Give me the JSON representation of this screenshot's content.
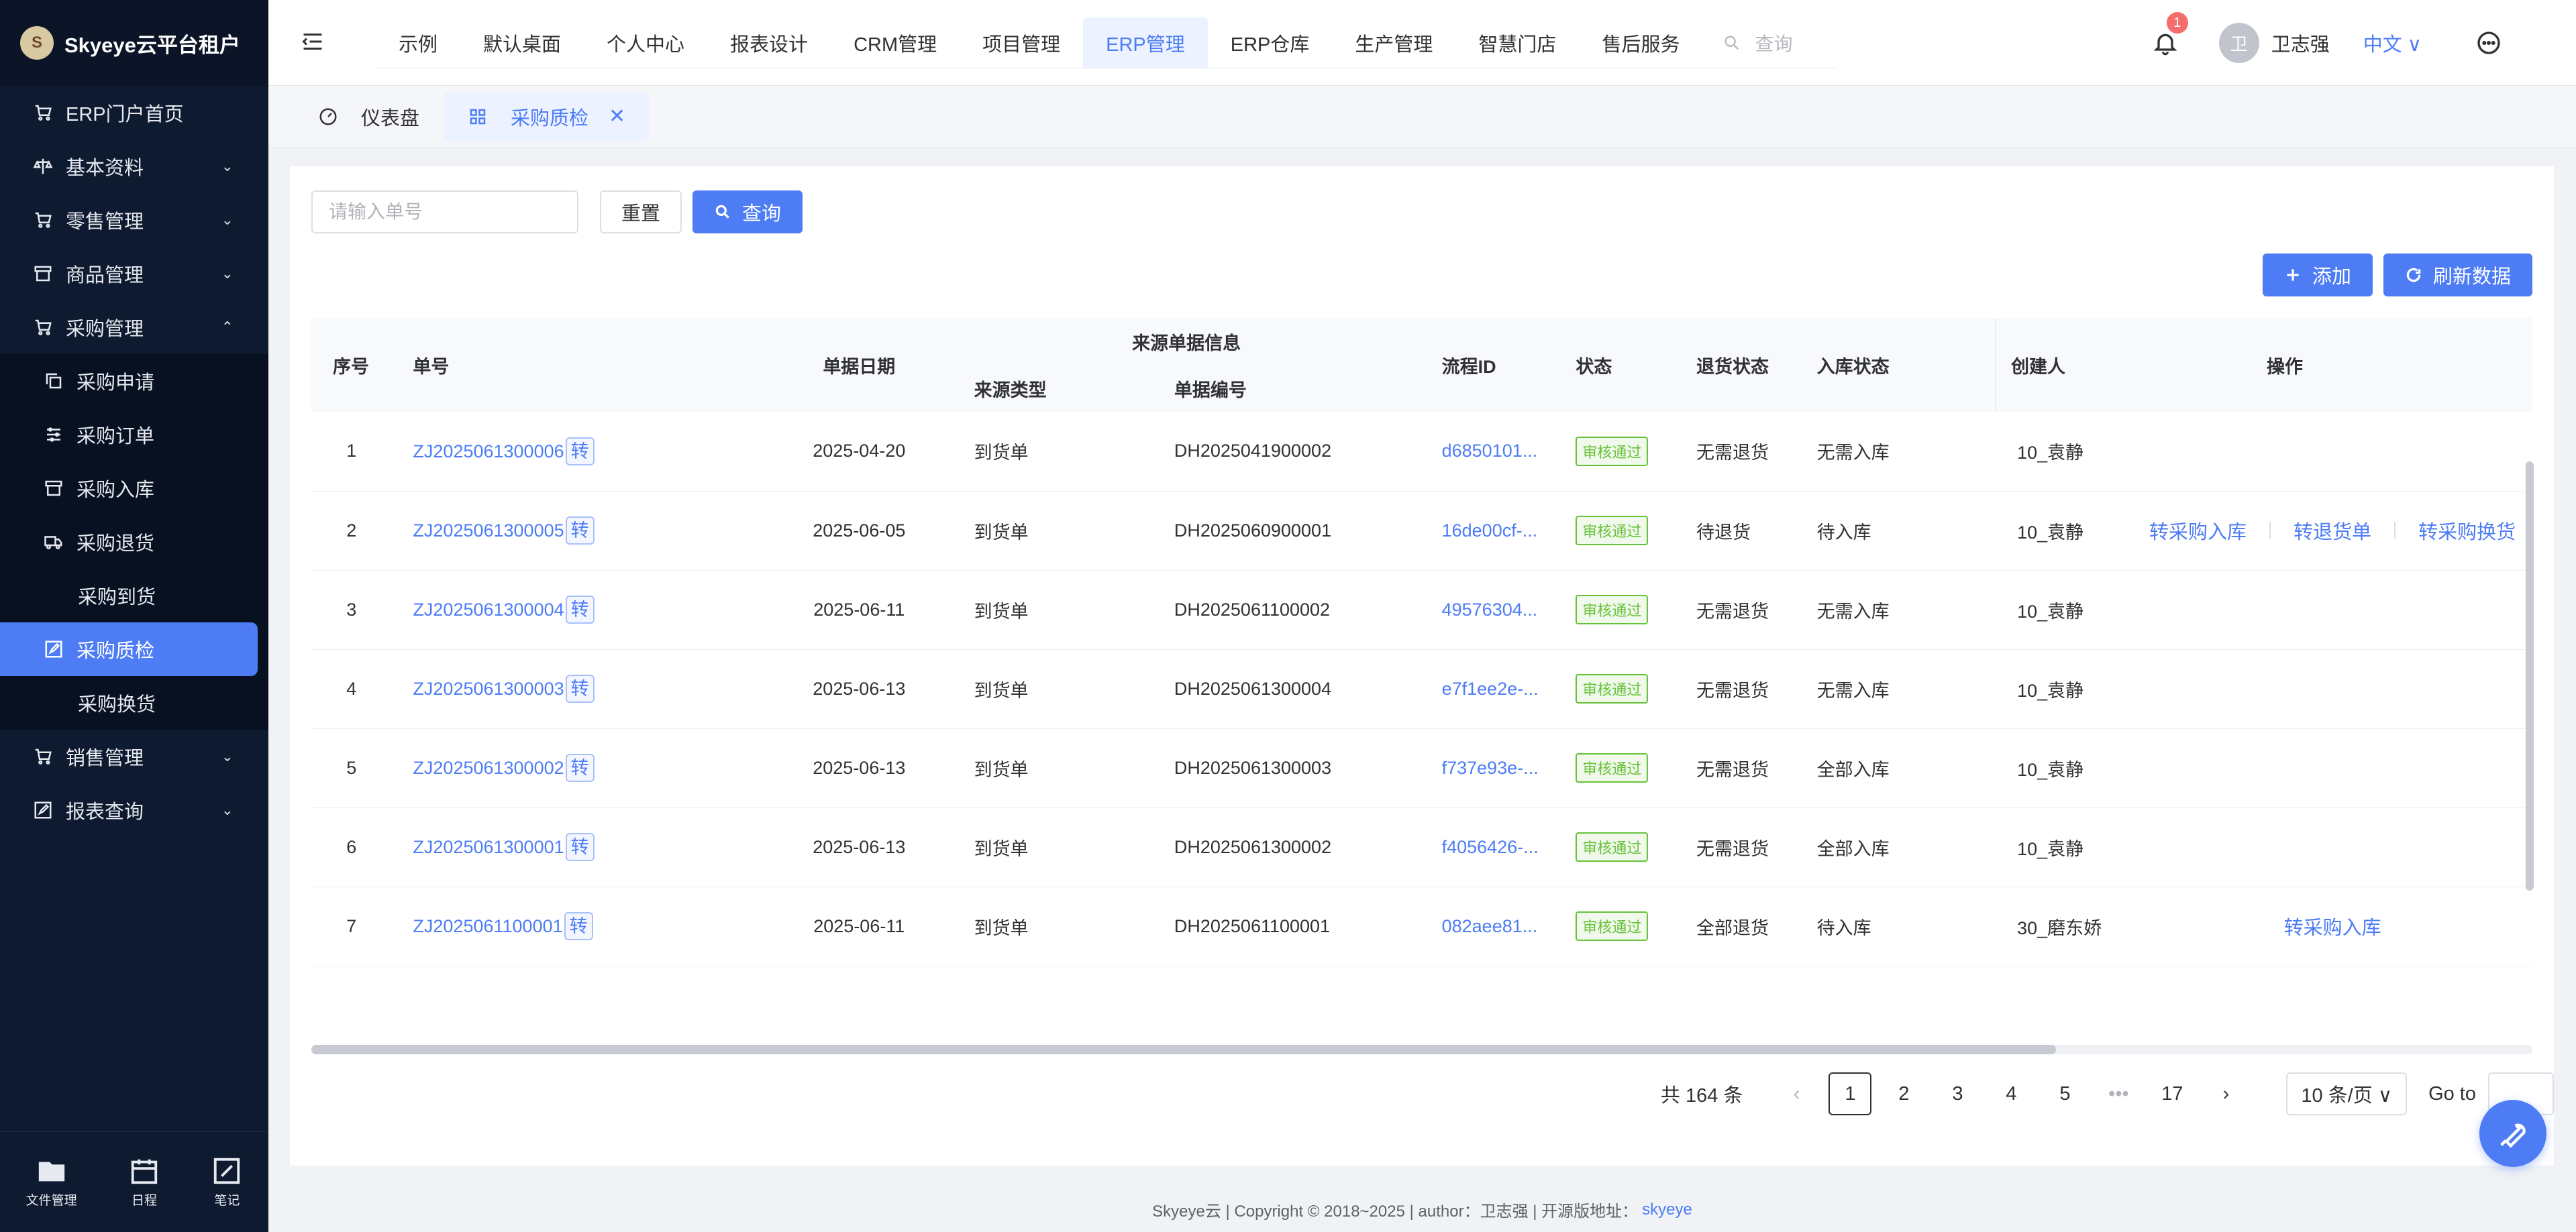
{
  "brand": {
    "title": "Skyeye云平台租户"
  },
  "sidebar": {
    "items": [
      {
        "label": "ERP门户首页",
        "icon": "cart-icon",
        "chevron": ""
      },
      {
        "label": "基本资料",
        "icon": "scale-icon",
        "chevron": "⌄"
      },
      {
        "label": "零售管理",
        "icon": "cart-icon",
        "chevron": "⌄"
      },
      {
        "label": "商品管理",
        "icon": "box-icon",
        "chevron": "⌄"
      },
      {
        "label": "采购管理",
        "icon": "cart-icon",
        "chevron": "⌃"
      }
    ],
    "sub_items": [
      {
        "label": "采购申请",
        "icon": "copy-icon"
      },
      {
        "label": "采购订单",
        "icon": "sliders-icon"
      },
      {
        "label": "采购入库",
        "icon": "box-icon"
      },
      {
        "label": "采购退货",
        "icon": "truck-icon"
      },
      {
        "label": "采购到货",
        "icon": ""
      },
      {
        "label": "采购质检",
        "icon": "edit-icon",
        "active": true
      },
      {
        "label": "采购换货",
        "icon": ""
      }
    ],
    "after_items": [
      {
        "label": "销售管理",
        "icon": "cart-icon",
        "chevron": "⌄"
      },
      {
        "label": "报表查询",
        "icon": "edit-icon",
        "chevron": "⌄"
      }
    ],
    "bottom": [
      {
        "label": "文件管理",
        "icon": "folder-icon"
      },
      {
        "label": "日程",
        "icon": "calendar-icon"
      },
      {
        "label": "笔记",
        "icon": "note-icon"
      }
    ]
  },
  "header": {
    "tabs": [
      "示例",
      "默认桌面",
      "个人中心",
      "报表设计",
      "CRM管理",
      "项目管理",
      "ERP管理",
      "ERP仓库",
      "生产管理",
      "智慧门店",
      "售后服务"
    ],
    "active_tab": "ERP管理",
    "search_placeholder": "查询",
    "notification_count": "1",
    "avatar_text": "卫",
    "username": "卫志强",
    "language": "中文 ∨"
  },
  "tagsbar": {
    "dashboard": "仪表盘",
    "current": "采购质检"
  },
  "filter": {
    "placeholder": "请输入单号",
    "reset": "重置",
    "query": "查询"
  },
  "toolbar": {
    "add": "添加",
    "refresh": "刷新数据"
  },
  "table": {
    "headers": {
      "index": "序号",
      "number": "单号",
      "date": "单据日期",
      "source_group": "来源单据信息",
      "source_type": "来源类型",
      "source_no": "单据编号",
      "flow_id": "流程ID",
      "status": "状态",
      "return_status": "退货状态",
      "stock_status": "入库状态",
      "creator": "创建人",
      "ops": "操作"
    },
    "zhuan_label": "转",
    "rows": [
      {
        "index": "1",
        "number": "ZJ2025061300006",
        "date": "2025-04-20",
        "source_type": "到货单",
        "source_no": "DH2025041900002",
        "flow_id": "d6850101...",
        "status": "审核通过",
        "return_status": "无需退货",
        "stock_status": "无需入库",
        "creator": "10_袁静",
        "ops": []
      },
      {
        "index": "2",
        "number": "ZJ2025061300005",
        "date": "2025-06-05",
        "source_type": "到货单",
        "source_no": "DH2025060900001",
        "flow_id": "16de00cf-...",
        "status": "审核通过",
        "return_status": "待退货",
        "stock_status": "待入库",
        "creator": "10_袁静",
        "ops": [
          "转采购入库",
          "转退货单",
          "转采购换货"
        ]
      },
      {
        "index": "3",
        "number": "ZJ2025061300004",
        "date": "2025-06-11",
        "source_type": "到货单",
        "source_no": "DH2025061100002",
        "flow_id": "49576304...",
        "status": "审核通过",
        "return_status": "无需退货",
        "stock_status": "无需入库",
        "creator": "10_袁静",
        "ops": []
      },
      {
        "index": "4",
        "number": "ZJ2025061300003",
        "date": "2025-06-13",
        "source_type": "到货单",
        "source_no": "DH2025061300004",
        "flow_id": "e7f1ee2e-...",
        "status": "审核通过",
        "return_status": "无需退货",
        "stock_status": "无需入库",
        "creator": "10_袁静",
        "ops": []
      },
      {
        "index": "5",
        "number": "ZJ2025061300002",
        "date": "2025-06-13",
        "source_type": "到货单",
        "source_no": "DH2025061300003",
        "flow_id": "f737e93e-...",
        "status": "审核通过",
        "return_status": "无需退货",
        "stock_status": "全部入库",
        "creator": "10_袁静",
        "ops": []
      },
      {
        "index": "6",
        "number": "ZJ2025061300001",
        "date": "2025-06-13",
        "source_type": "到货单",
        "source_no": "DH2025061300002",
        "flow_id": "f4056426-...",
        "status": "审核通过",
        "return_status": "无需退货",
        "stock_status": "全部入库",
        "creator": "10_袁静",
        "ops": []
      },
      {
        "index": "7",
        "number": "ZJ2025061100001",
        "date": "2025-06-11",
        "source_type": "到货单",
        "source_no": "DH2025061100001",
        "flow_id": "082aee81...",
        "status": "审核通过",
        "return_status": "全部退货",
        "stock_status": "待入库",
        "creator": "30_磨东娇",
        "ops": [
          "转采购入库"
        ]
      }
    ]
  },
  "pager": {
    "total": "共 164 条",
    "pages": [
      "1",
      "2",
      "3",
      "4",
      "5"
    ],
    "ellipsis": "•••",
    "last": "17",
    "current": "1",
    "size": "10 条/页 ∨",
    "goto": "Go to"
  },
  "footer": {
    "text": "Skyeye云 | Copyright © 2018~2025 | author：卫志强 | 开源版地址：",
    "link": "skyeye"
  },
  "colors": {
    "primary": "#4d7cf5",
    "sidebar_bg": "#0e1a2f",
    "success": "#67c23a",
    "badge": "#f56c6c"
  }
}
